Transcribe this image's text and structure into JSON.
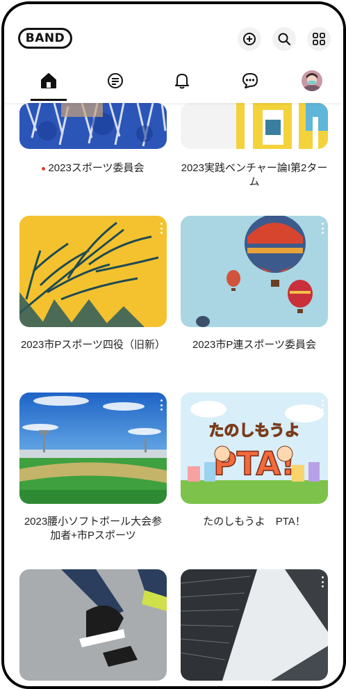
{
  "app": {
    "logo_text": "BAND"
  },
  "header": {
    "buttons": [
      {
        "icon": "add-icon"
      },
      {
        "icon": "search-icon"
      },
      {
        "icon": "grid-icon"
      }
    ]
  },
  "tabs": [
    {
      "icon": "home-icon",
      "active": true
    },
    {
      "icon": "feed-icon",
      "active": false
    },
    {
      "icon": "bell-icon",
      "active": false
    },
    {
      "icon": "chat-icon",
      "active": false
    },
    {
      "icon": "profile-avatar",
      "active": false
    }
  ],
  "bands": [
    {
      "name": "2023スポーツ委員会",
      "unread": true
    },
    {
      "name": "2023実践ベンチャー論I第2ターム",
      "unread": false
    },
    {
      "name": "2023市Pスポーツ四役（旧新）",
      "unread": false
    },
    {
      "name": "2023市P連スポーツ委員会",
      "unread": false
    },
    {
      "name": "2023腰小ソフトボール大会参加者+市Pスポーツ",
      "unread": false
    },
    {
      "name": "たのしもうよ　PTA！",
      "unread": false
    },
    {
      "name": "",
      "unread": false
    },
    {
      "name": "",
      "unread": false
    }
  ],
  "cover_art": {
    "pta_banner_text": "たのしもうよ PTA!"
  },
  "colors": {
    "accent": "#111111",
    "unread_dot": "#e53935"
  }
}
